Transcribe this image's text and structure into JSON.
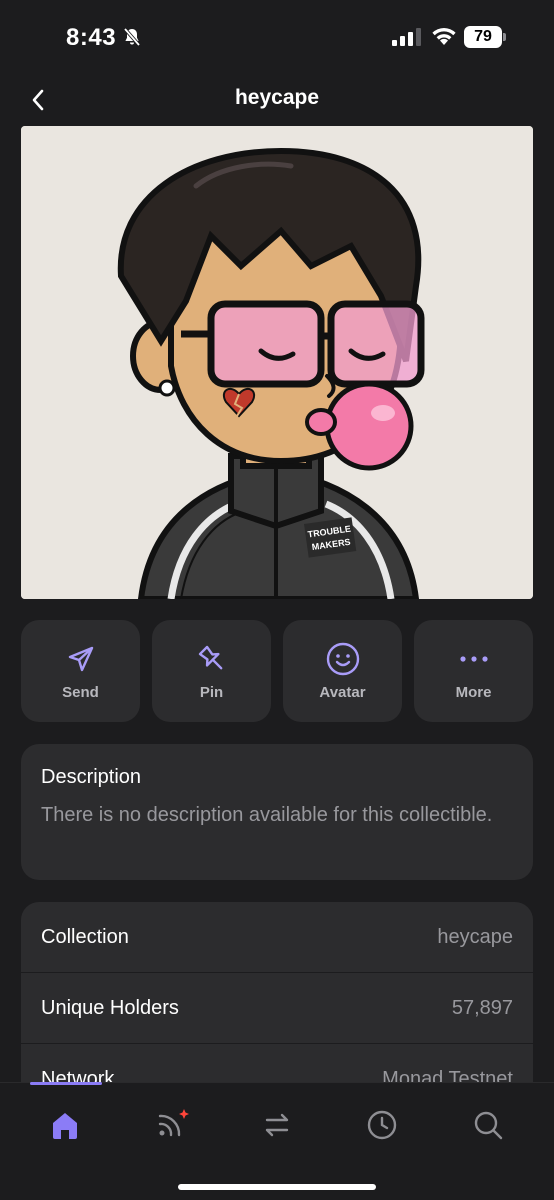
{
  "status_bar": {
    "time": "8:43",
    "battery": "79"
  },
  "header": {
    "title": "heycape"
  },
  "nft": {
    "badge_text_line1": "TROUBLE",
    "badge_text_line2": "MAKERS"
  },
  "actions": [
    {
      "label": "Send",
      "icon": "send-icon"
    },
    {
      "label": "Pin",
      "icon": "pin-icon"
    },
    {
      "label": "Avatar",
      "icon": "smiley-icon"
    },
    {
      "label": "More",
      "icon": "more-dots-icon"
    }
  ],
  "description": {
    "title": "Description",
    "text": "There is no description available for this collectible."
  },
  "info": [
    {
      "label": "Collection",
      "value": "heycape"
    },
    {
      "label": "Unique Holders",
      "value": "57,897"
    },
    {
      "label": "Network",
      "value": "Monad Testnet"
    }
  ],
  "tabs": [
    {
      "name": "home",
      "icon": "home-icon",
      "active": true
    },
    {
      "name": "feed",
      "icon": "feed-icon",
      "active": false
    },
    {
      "name": "swap",
      "icon": "swap-icon",
      "active": false
    },
    {
      "name": "history",
      "icon": "clock-icon",
      "active": false
    },
    {
      "name": "search",
      "icon": "search-icon",
      "active": false
    }
  ],
  "colors": {
    "accent": "#8b7cf6",
    "background": "#1c1c1e",
    "card": "#2c2c2e",
    "notification": "#ff453a"
  }
}
